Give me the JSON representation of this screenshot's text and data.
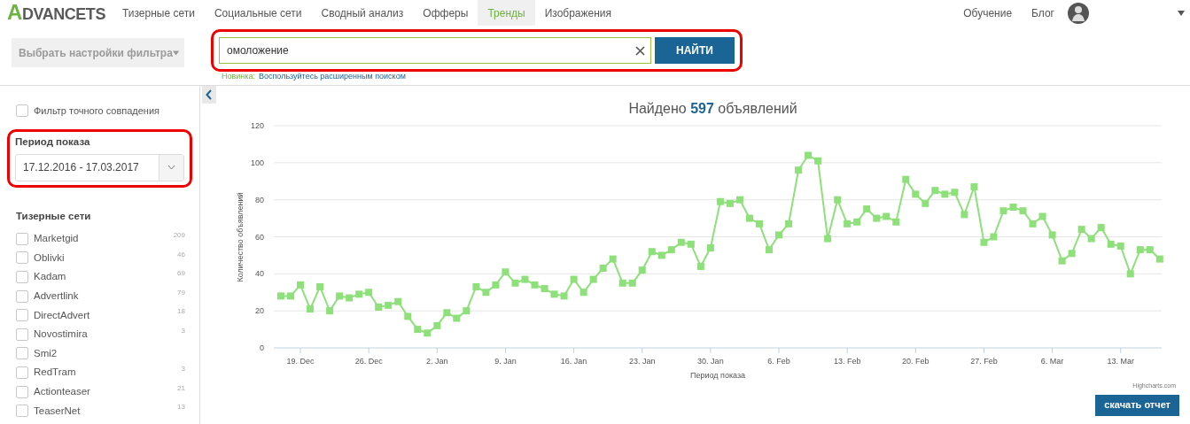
{
  "logo": "ADVANCETS",
  "nav": [
    {
      "label": "Тизерные сети",
      "selected": false
    },
    {
      "label": "Социальные сети",
      "selected": false
    },
    {
      "label": "Сводный анализ",
      "selected": false
    },
    {
      "label": "Офферы",
      "selected": false
    },
    {
      "label": "Тренды",
      "selected": true
    },
    {
      "label": "Изображения",
      "selected": false
    }
  ],
  "nav_right": [
    "Обучение",
    "Блог"
  ],
  "filter_preset": {
    "label": "Выбрать настройки фильтра",
    "disabled": true
  },
  "search": {
    "value": "омоложение",
    "button": "НАЙТИ",
    "hint_label": "Новинка:",
    "hint_link": "Воспользуйтесь расширенным поиском"
  },
  "sidebar": {
    "exact_match": {
      "label": "Фильтр точного совпадения",
      "checked": false
    },
    "period": {
      "heading": "Период показа",
      "value": "17.12.2016 - 17.03.2017"
    },
    "networks_heading": "Тизерные сети",
    "networks": [
      {
        "name": "Marketgid",
        "count": "209",
        "checked": false
      },
      {
        "name": "Oblivki",
        "count": "46",
        "checked": false
      },
      {
        "name": "Kadam",
        "count": "69",
        "checked": false
      },
      {
        "name": "Advertlink",
        "count": "79",
        "checked": false
      },
      {
        "name": "DirectAdvert",
        "count": "18",
        "checked": false
      },
      {
        "name": "Novostimira",
        "count": "3",
        "checked": false
      },
      {
        "name": "Smi2",
        "checked": false
      },
      {
        "name": "RedTram",
        "count": "3",
        "checked": false
      },
      {
        "name": "Actionteaser",
        "count": "21",
        "checked": false
      },
      {
        "name": "TeaserNet",
        "count": "13",
        "checked": false
      }
    ]
  },
  "results_title": "Найдено **597** объявлений",
  "chart": {
    "credit": "Highcharts.com",
    "download_button": "скачать отчет",
    "chart_data": {
      "type": "line",
      "xlabel": "Период показа",
      "ylabel": "Количество объявлений",
      "categories": [
        null,
        null,
        "19. Dec",
        null,
        null,
        null,
        null,
        null,
        null,
        "26. Dec",
        null,
        null,
        null,
        null,
        null,
        null,
        "2. Jan",
        null,
        null,
        null,
        null,
        null,
        null,
        "9. Jan",
        null,
        null,
        null,
        null,
        null,
        null,
        "16. Jan",
        null,
        null,
        null,
        null,
        null,
        null,
        "23. Jan",
        null,
        null,
        null,
        null,
        null,
        null,
        "30. Jan",
        null,
        null,
        null,
        null,
        null,
        null,
        "6. Feb",
        null,
        null,
        null,
        null,
        null,
        null,
        "13. Feb",
        null,
        null,
        null,
        null,
        null,
        null,
        "20. Feb",
        null,
        null,
        null,
        null,
        null,
        null,
        "27. Feb",
        null,
        null,
        null,
        null,
        null,
        null,
        "6. Mar",
        null,
        null,
        null,
        null,
        null,
        null,
        "13. Mar",
        null,
        null,
        null,
        null
      ],
      "grid": true,
      "series": [
        {
          "color": "#8ee07a",
          "marker": "square",
          "values": [
            28,
            28,
            34,
            21,
            33,
            20,
            28,
            27,
            29,
            30,
            22,
            23,
            25,
            17,
            10,
            8,
            12,
            19,
            16,
            20,
            33,
            30,
            34,
            41,
            35,
            37,
            34,
            32,
            29,
            28,
            37,
            30,
            37,
            43,
            48,
            35,
            35,
            42,
            52,
            50,
            53,
            57,
            56,
            44,
            54,
            79,
            78,
            80,
            70,
            67,
            53,
            61,
            67,
            96,
            104,
            101,
            59,
            80,
            67,
            68,
            75,
            70,
            71,
            68,
            91,
            83,
            78,
            85,
            83,
            84,
            72,
            87,
            57,
            60,
            74,
            76,
            74,
            67,
            71,
            61,
            47,
            51,
            64,
            59,
            65,
            56,
            55,
            40,
            53,
            53,
            48
          ]
        }
      ],
      "ylim": [
        0,
        120
      ],
      "yticks": [
        0,
        20,
        40,
        60,
        80,
        100,
        120
      ]
    }
  }
}
